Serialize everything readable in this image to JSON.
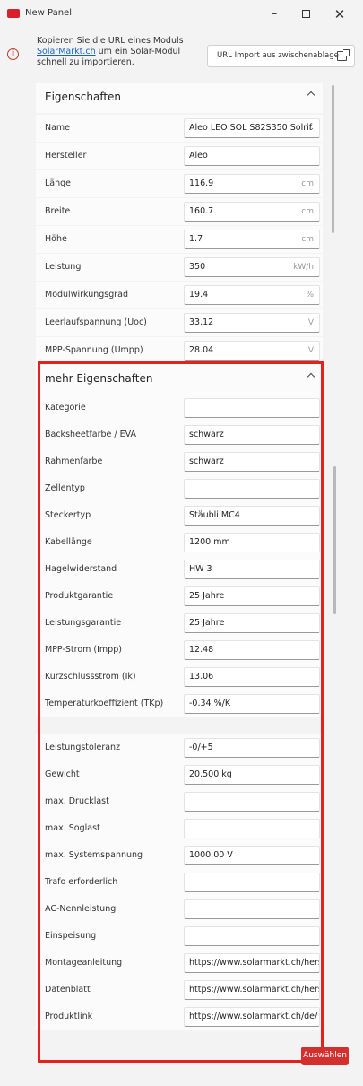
{
  "window": {
    "title": "New Panel",
    "minimize": "–",
    "close": "✕"
  },
  "info": {
    "text_before": "Kopieren Sie die URL eines Moduls ",
    "link": "SolarMarkt.ch",
    "text_after": " um ein Solar-Modul schnell zu importieren.",
    "import_button": "URL Import aus zwischenablage",
    "icon": "info-icon"
  },
  "eigenschaften": {
    "title": "Eigenschaften",
    "rows": [
      {
        "label": "Name",
        "value": "Aleo LEO SOL S82S350 Solrif",
        "unit": "",
        "dropdown": true
      },
      {
        "label": "Hersteller",
        "value": "Aleo",
        "unit": ""
      },
      {
        "label": "Länge",
        "value": "116.9",
        "unit": "cm"
      },
      {
        "label": "Breite",
        "value": "160.7",
        "unit": "cm"
      },
      {
        "label": "Höhe",
        "value": "1.7",
        "unit": "cm"
      },
      {
        "label": "Leistung",
        "value": "350",
        "unit": "kW/h"
      },
      {
        "label": "Modulwirkungsgrad",
        "value": "19.4",
        "unit": "%"
      },
      {
        "label": "Leerlaufspannung (Uoc)",
        "value": "33.12",
        "unit": "V"
      },
      {
        "label": "MPP-Spannung (Umpp)",
        "value": "28.04",
        "unit": "V"
      }
    ]
  },
  "mehr": {
    "title": "mehr Eigenschaften",
    "rows": [
      {
        "label": "Kategorie",
        "value": ""
      },
      {
        "label": "Backsheetfarbe / EVA",
        "value": "schwarz"
      },
      {
        "label": "Rahmenfarbe",
        "value": "schwarz"
      },
      {
        "label": "Zellentyp",
        "value": ""
      },
      {
        "label": "Steckertyp",
        "value": "Stäubli MC4"
      },
      {
        "label": "Kabellänge",
        "value": "1200 mm"
      },
      {
        "label": "Hagelwiderstand",
        "value": "HW 3"
      },
      {
        "label": "Produktgarantie",
        "value": "25 Jahre"
      },
      {
        "label": "Leistungsgarantie",
        "value": "25 Jahre"
      },
      {
        "label": "MPP-Strom (Impp)",
        "value": "12.48"
      },
      {
        "label": "Kurzschlussstrom (Ik)",
        "value": "13.06"
      },
      {
        "label": "Temperaturkoeffizient (TKp)",
        "value": "-0.34 %/K"
      },
      {
        "label": "Leistungstoleranz",
        "value": "-0/+5"
      },
      {
        "label": "Gewicht",
        "value": "20.500 kg"
      },
      {
        "label": "max. Drucklast",
        "value": ""
      },
      {
        "label": "max. Soglast",
        "value": ""
      },
      {
        "label": "max. Systemspannung",
        "value": "1000.00 V"
      },
      {
        "label": "Trafo erforderlich",
        "value": ""
      },
      {
        "label": "AC-Nennleistung",
        "value": ""
      },
      {
        "label": "Einspeisung",
        "value": ""
      },
      {
        "label": "Montageanleitung",
        "value": "https://www.solarmarkt.ch/hers"
      },
      {
        "label": "Datenblatt",
        "value": "https://www.solarmarkt.ch/hers"
      },
      {
        "label": "Produktlink",
        "value": "https://www.solarmarkt.ch/de/"
      }
    ]
  },
  "footer": {
    "select_button": "Auswählen"
  },
  "colors": {
    "accent": "#d32f2f",
    "highlight": "#e8201c",
    "link": "#1565c0"
  }
}
